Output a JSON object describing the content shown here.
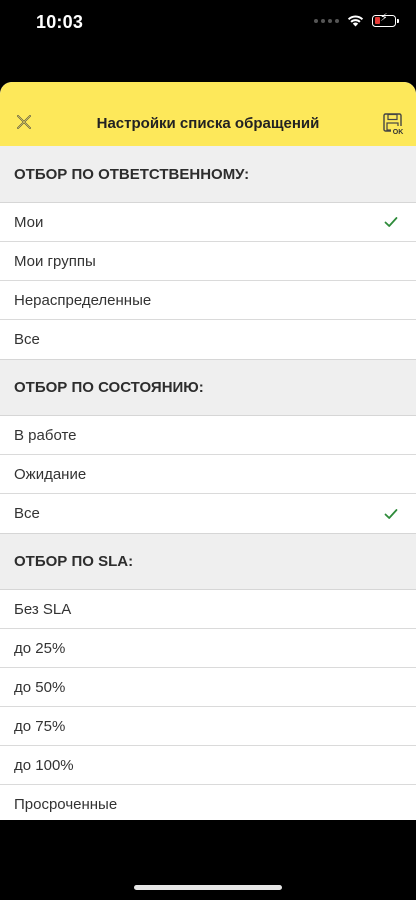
{
  "status_bar": {
    "time": "10:03"
  },
  "header": {
    "title": "Настройки списка обращений",
    "close_icon": "close-icon",
    "save_icon": "save-ok-icon",
    "background": "#fde85a"
  },
  "sections": [
    {
      "title": "ОТБОР ПО ОТВЕТСТВЕННОМУ:",
      "items": [
        {
          "label": "Мои",
          "checked": true
        },
        {
          "label": "Мои группы",
          "checked": false
        },
        {
          "label": "Нераспределенные",
          "checked": false
        },
        {
          "label": "Все",
          "checked": false
        }
      ]
    },
    {
      "title": "ОТБОР ПО СОСТОЯНИЮ:",
      "items": [
        {
          "label": "В работе",
          "checked": false
        },
        {
          "label": "Ожидание",
          "checked": false
        },
        {
          "label": "Все",
          "checked": true
        }
      ]
    },
    {
      "title": "ОТБОР ПО SLA:",
      "items": [
        {
          "label": "Без SLA",
          "checked": false
        },
        {
          "label": "до 25%",
          "checked": false
        },
        {
          "label": "до 50%",
          "checked": false
        },
        {
          "label": "до 75%",
          "checked": false
        },
        {
          "label": "до 100%",
          "checked": false
        },
        {
          "label": "Просроченные",
          "checked": false
        }
      ]
    }
  ],
  "colors": {
    "check": "#2e8b3a",
    "accent": "#fde85a"
  }
}
